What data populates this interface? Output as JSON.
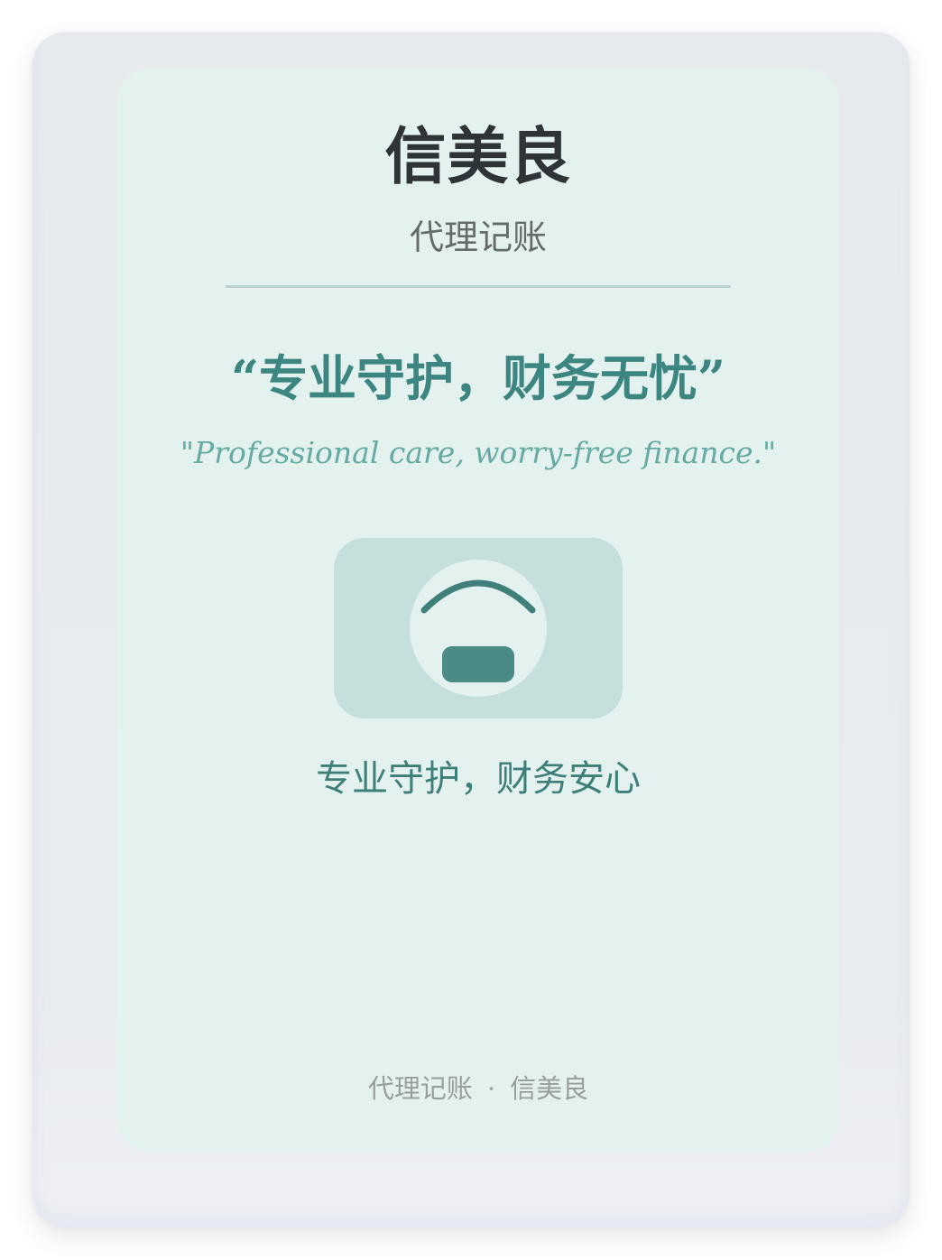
{
  "brand": {
    "name": "信美良",
    "subtitle": "代理记账"
  },
  "slogan": {
    "chinese": "“专业守护，财务无忧”",
    "english": "\"Professional care, worry-free finance.\""
  },
  "emblem": {
    "icon": "shield-emblem-icon",
    "accent_color": "#3f7f7a",
    "background_color": "#c5dfdc",
    "circle_color": "#e3f1ef"
  },
  "tagline": "专业守护，财务安心",
  "footer": {
    "left": "代理记账",
    "separator": "·",
    "right": "信美良"
  },
  "colors": {
    "page_background": "#e8ebee",
    "panel_background": "#e4f2ef",
    "title": "#2f3337",
    "slogan": "#3d8580",
    "slogan_english": "#66aaa3",
    "divider": "#b8d3d1",
    "footer_text": "#9a9d9f"
  }
}
